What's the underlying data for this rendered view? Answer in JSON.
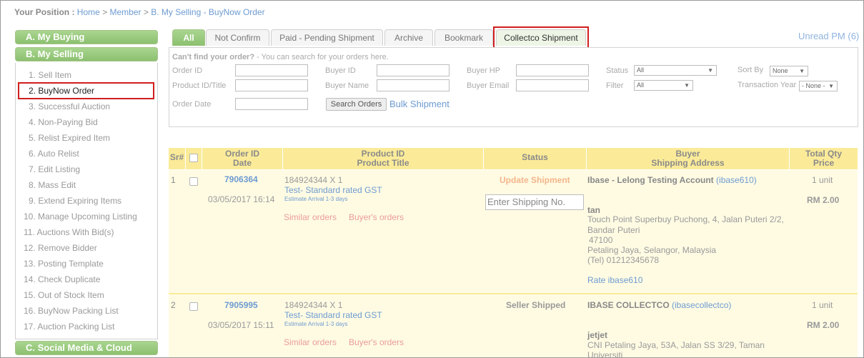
{
  "breadcrumb": {
    "prefix": "Your Position :",
    "home": "Home",
    "member": "Member",
    "current": "B. My Selling - BuyNow Order",
    "sep": ">"
  },
  "sidebar": {
    "my_buying": "A. My Buying",
    "my_selling": "B. My Selling",
    "social": "C. Social Media & Cloud",
    "items": [
      "1. Sell Item",
      "2. BuyNow Order",
      "3. Successful Auction",
      "4. Non-Paying Bid",
      "5. Relist Expired Item",
      "6. Auto Relist",
      "7. Edit Listing",
      "8. Mass Edit",
      "9. Extend Expiring Items",
      "10. Manage Upcoming Listing",
      "11. Auctions With Bid(s)",
      "12. Remove Bidder",
      "13. Posting Template",
      "14. Check Duplicate",
      "15. Out of Stock Item",
      "16. BuyNow Packing List",
      "17. Auction Packing List"
    ]
  },
  "tabs": [
    "All",
    "Not Confirm",
    "Paid - Pending Shipment",
    "Archive",
    "Bookmark",
    "Collectco Shipment"
  ],
  "unread_pm": "Unread PM (6)",
  "search": {
    "help_bold": "Can't find your order?",
    "help_rest": " - You can search for your orders here.",
    "order_id": "Order ID",
    "buyer_id": "Buyer ID",
    "buyer_hp": "Buyer HP",
    "status": "Status",
    "sort_by": "Sort By",
    "product_id_title": "Product ID/Title",
    "buyer_name": "Buyer Name",
    "buyer_email": "Buyer Email",
    "filter": "Filter",
    "transaction_year": "Transaction Year",
    "order_date": "Order Date",
    "status_value": "All",
    "sort_value": "None",
    "filter_value": "All",
    "year_value": "- None -",
    "search_btn": "Search Orders",
    "bulk": "Bulk Shipment"
  },
  "table": {
    "headers": {
      "sr": "Sr#",
      "order_id": "Order ID",
      "date": "Date",
      "product_id": "Product ID",
      "product_title": "Product Title",
      "status": "Status",
      "buyer": "Buyer",
      "shipping": "Shipping Address",
      "total_qty": "Total Qty",
      "price": "Price"
    },
    "rows": [
      {
        "sr": "1",
        "order_id": "7906364",
        "date": "03/05/2017 16:14",
        "product_line": "184924344 X 1",
        "product_title": "Test- Standard rated GST",
        "estimate": "Estimate Arrival 1-3 days",
        "similar": "Similar orders",
        "buyers_orders": "Buyer's orders",
        "status": "Update Shipment",
        "shipping_placeholder": "Enter Shipping No.",
        "buyer_name": "Ibase - Lelong Testing Account",
        "buyer_id": "(ibase610)",
        "qty": "1 unit",
        "price": "RM 2.00",
        "recipient": "tan",
        "addr1": "Touch Point Superbuy Puchong, 4, Jalan Puteri 2/2,",
        "addr2": "Bandar Puteri",
        "addr3": "47100",
        "addr4": "Petaling Jaya,  Selangor,  Malaysia",
        "tel": "(Tel) 01212345678",
        "rate": "Rate ibase610"
      },
      {
        "sr": "2",
        "order_id": "7905995",
        "date": "03/05/2017 15:11",
        "product_line": "184924344 X 1",
        "product_title": "Test- Standard rated GST",
        "estimate": "Estimate Arrival 1-3 days",
        "similar": "Similar orders",
        "buyers_orders": "Buyer's orders",
        "status": "Seller Shipped",
        "buyer_name": "IBASE COLLECTCO",
        "buyer_id": "(ibasecollectco)",
        "qty": "1 unit",
        "price": "RM 2.00",
        "recipient": "jetjet",
        "addr1": "CNI Petaling Jaya, 53A, Jalan SS 3/29, Taman",
        "addr2": "Universiti"
      }
    ]
  },
  "colors": {
    "accent_green": "#8cc06f",
    "link_blue": "#6d9bd1",
    "highlight_red": "#d01f1f",
    "header_yellow": "#fbeb99",
    "row_yellow": "#fffbe3"
  }
}
